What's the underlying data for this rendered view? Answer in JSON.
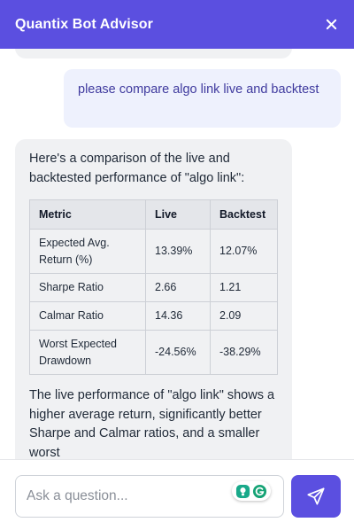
{
  "header": {
    "title": "Quantix Bot Advisor",
    "close_icon": "close-icon"
  },
  "colors": {
    "brand": "#5b4fe0",
    "user_bubble_bg": "#eef1fd",
    "user_text": "#3f3a9e",
    "bot_bubble_bg": "#f0f1f3"
  },
  "messages": {
    "user": {
      "text": "please compare algo link live and backtest"
    },
    "bot": {
      "intro": "Here's a comparison of the live and backtested performance of \"algo link\":",
      "table": {
        "headers": [
          "Metric",
          "Live",
          "Backtest"
        ],
        "rows": [
          [
            "Expected Avg. Return (%)",
            "13.39%",
            "12.07%"
          ],
          [
            "Sharpe Ratio",
            "2.66",
            "1.21"
          ],
          [
            "Calmar Ratio",
            "14.36",
            "2.09"
          ],
          [
            "Worst Expected Drawdown",
            "-24.56%",
            "-38.29%"
          ]
        ]
      },
      "outro": "The live performance of \"algo link\" shows a higher average return, significantly better Sharpe and Calmar ratios, and a smaller worst"
    }
  },
  "input": {
    "placeholder": "Ask a question...",
    "value": ""
  },
  "extension_icons": [
    "grammar-assistant-icon",
    "grammarly-icon"
  ],
  "send_icon": "paper-plane-icon"
}
